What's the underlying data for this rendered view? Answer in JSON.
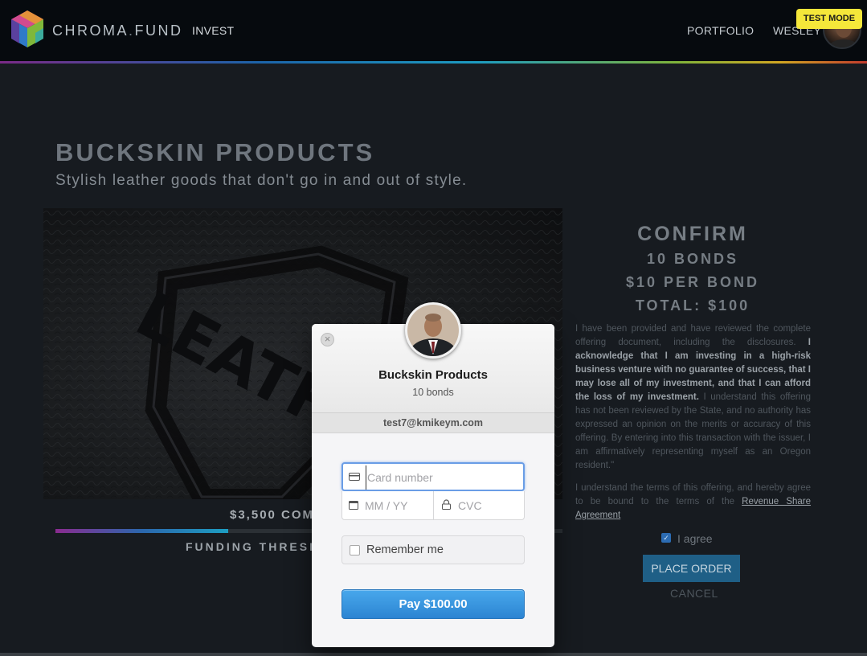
{
  "navbar": {
    "brand_main": "CHROMA",
    "brand_dot": ".",
    "brand_sub": "FUND",
    "invest_label": "INVEST",
    "portfolio_label": "PORTFOLIO",
    "user_label": "WESLEY",
    "test_mode_badge": "TEST MODE",
    "stripe_colors": [
      "#7a2a86",
      "#1c63a8",
      "#1d9bc0",
      "#7fb33a",
      "#d1a622",
      "#c23a2d"
    ]
  },
  "project": {
    "title": "BUCKSKIN PRODUCTS",
    "subtitle": "Stylish leather goods that don't go in and out of style.",
    "hero_emboss_text": "LEATH",
    "raised_label": "$3,500 COM",
    "funding_label": "FUNDING THRESH",
    "progress_fraction": 0.34
  },
  "confirm": {
    "title": "CONFIRM",
    "bonds": "10 BONDS",
    "per_bond": "$10 PER BOND",
    "total": "TOTAL: $100",
    "legal_pre": "I have been provided and have reviewed the complete offering document, including the disclosures. ",
    "legal_strong": "I acknowledge that I am investing in a high-risk business venture with no guarantee of success, that I may lose all of my investment, and that I can afford the loss of my investment.",
    "legal_post": " I understand this offering has not been reviewed by the State, and no authority has expressed an opinion on the merits or accuracy of this offering. By entering into this transaction with the issuer, I am affirmatively representing myself as an Oregon resident.\"",
    "terms_pre": "I understand the terms of this offering, and hereby agree to be bound to the terms of the ",
    "terms_link": "Revenue Share Agreement",
    "agree_label": "I agree",
    "agree_checked": true,
    "place_order_label": "PLACE ORDER",
    "cancel_label": "CANCEL"
  },
  "payment": {
    "merchant_name": "Buckskin Products",
    "description": "10 bonds",
    "email": "test7@kmikeym.com",
    "card_placeholder": "Card number",
    "expiry_placeholder": "MM / YY",
    "cvc_placeholder": "CVC",
    "remember_label": "Remember me",
    "pay_label": "Pay $100.00",
    "accent_color": "#2c84d2"
  }
}
